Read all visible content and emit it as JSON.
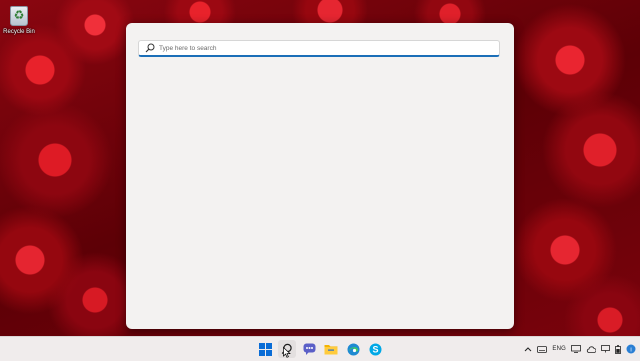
{
  "desktop": {
    "icons": [
      {
        "label": "Recycle Bin",
        "icon": "recycle-bin-icon"
      }
    ]
  },
  "search": {
    "placeholder": "Type here to search",
    "value": ""
  },
  "taskbar": {
    "apps": [
      {
        "name": "Start",
        "icon": "windows-start-icon"
      },
      {
        "name": "Search",
        "icon": "search-icon",
        "active": true
      },
      {
        "name": "Chat",
        "icon": "chat-icon"
      },
      {
        "name": "File Explorer",
        "icon": "folder-icon"
      },
      {
        "name": "Microsoft Edge",
        "icon": "edge-icon"
      },
      {
        "name": "Skype",
        "icon": "skype-icon"
      }
    ],
    "tray": {
      "language": "ENG",
      "icons": [
        "chevron-up-icon",
        "keyboard-icon",
        "display-icon",
        "cloud-icon",
        "network-icon",
        "battery-icon",
        "notification-icon"
      ]
    }
  },
  "colors": {
    "accent": "#1b6fb8",
    "panel_bg": "#f3f2f1",
    "taskbar_bg": "#f0ecec"
  }
}
